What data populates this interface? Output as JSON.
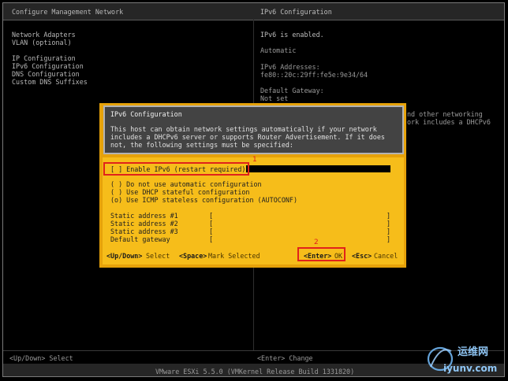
{
  "header": {
    "left_title": "Configure Management Network",
    "right_title": "IPv6 Configuration"
  },
  "menu": {
    "items": [
      "Network Adapters",
      "VLAN (optional)",
      "IP Configuration",
      "IPv6 Configuration",
      "DNS Configuration",
      "Custom DNS Suffixes"
    ]
  },
  "info": {
    "status": "IPv6 is enabled.",
    "mode": "Automatic",
    "addresses_label": "IPv6 Addresses:",
    "address": "fe80::20c:29ff:fe5e:9e34/64",
    "gateway_label": "Default Gateway:",
    "gateway_value": "Not set",
    "partial_line1": "nd other networking",
    "partial_line2": "ork includes a DHCPv6"
  },
  "dialog": {
    "title": "IPv6 Configuration",
    "desc": [
      "This host can obtain network settings automatically if your network",
      "includes a DHCPv6 server or supports Router Advertisement. If it does",
      "not, the following settings must be specified:"
    ],
    "enable_checkbox": "[ ] Enable IPv6 (restart required)",
    "radio_options": [
      "( ) Do not use automatic configuration",
      "( ) Use DHCP stateful configuration",
      "(o) Use ICMP stateless configuration (AUTOCONF)"
    ],
    "fields": [
      {
        "label": "Static address #1",
        "open": "[",
        "close": "]"
      },
      {
        "label": "Static address #2",
        "open": "[",
        "close": "]"
      },
      {
        "label": "Static address #3",
        "open": "[",
        "close": "]"
      },
      {
        "label": "Default gateway",
        "open": "[",
        "close": "]"
      }
    ],
    "hint_select_key": "<Up/Down>",
    "hint_select": "Select",
    "hint_mark_key": "<Space>",
    "hint_mark": "Mark Selected",
    "hint_ok_key": "<Enter>",
    "hint_ok": "OK",
    "hint_cancel_key": "<Esc>",
    "hint_cancel": "Cancel",
    "annotation_1": "1",
    "annotation_2": "2"
  },
  "footer": {
    "left_hint": "<Up/Down> Select",
    "right_hint": "<Enter> Change",
    "status": "VMware ESXi 5.5.0 (VMKernel Release Build 1331820)"
  },
  "watermark": {
    "text_top": "运维网",
    "text_bottom": "iyunv.com"
  },
  "colors": {
    "console_bg": "#000000",
    "dialog_body": "#f6bd1a",
    "dialog_header": "#434343",
    "annotation_red": "#e0221b"
  }
}
